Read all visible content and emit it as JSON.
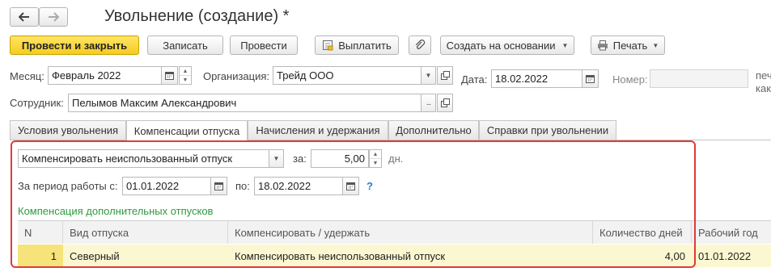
{
  "window": {
    "title": "Увольнение (создание) *"
  },
  "nav": {
    "back_icon": "arrow-left-icon",
    "forward_icon": "arrow-right-icon"
  },
  "toolbar": {
    "post_close_label": "Провести и закрыть",
    "save_label": "Записать",
    "post_label": "Провести",
    "pay_label": "Выплатить",
    "create_based_label": "Создать на основании",
    "print_label": "Печать"
  },
  "header": {
    "month_label": "Месяц:",
    "month_value": "Февраль 2022",
    "org_label": "Организация:",
    "org_value": "Трейд ООО",
    "date_label": "Дата:",
    "date_value": "18.02.2022",
    "number_label": "Номер:",
    "number_value": "",
    "cut_text_1": "печ",
    "cut_text_2": "как",
    "employee_label": "Сотрудник:",
    "employee_value": "Пелымов Максим Александрович"
  },
  "tabs": [
    {
      "label": "Условия увольнения"
    },
    {
      "label": "Компенсации отпуска"
    },
    {
      "label": "Начисления и удержания"
    },
    {
      "label": "Дополнительно"
    },
    {
      "label": "Справки при увольнении"
    }
  ],
  "compensation": {
    "mode_value": "Компенсировать неиспользованный отпуск",
    "days_label": "за:",
    "days_value": "5,00",
    "days_unit": "дн.",
    "period_label": "За период работы с:",
    "period_from": "01.01.2022",
    "period_to_label": "по:",
    "period_to": "18.02.2022",
    "help_label": "?",
    "additional_header": "Компенсация дополнительных отпусков"
  },
  "table": {
    "columns": [
      "N",
      "Вид отпуска",
      "Компенсировать / удержать",
      "Количество дней",
      "Рабочий год"
    ],
    "rows": [
      {
        "n": "1",
        "type": "Северный",
        "action": "Компенсировать неиспользованный отпуск",
        "days": "4,00",
        "year": "01.01.2022"
      }
    ]
  },
  "colors": {
    "highlight_border": "#e03a3a",
    "primary_button": "#f5cc1f",
    "section_header": "#2e9a3e",
    "selected_row": "#fbf7d0",
    "help": "#2a7ac9"
  }
}
